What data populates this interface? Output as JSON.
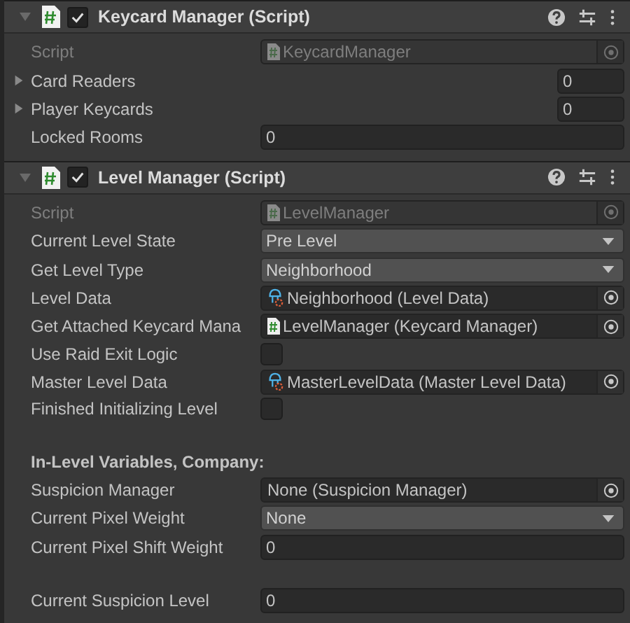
{
  "components": [
    {
      "title": "Keycard Manager (Script)",
      "expanded": true,
      "enabled": true,
      "fields": [
        {
          "kind": "script",
          "label": "Script",
          "value": "KeycardManager"
        },
        {
          "kind": "array",
          "label": "Card Readers",
          "value": "0",
          "expanded": false
        },
        {
          "kind": "array",
          "label": "Player Keycards",
          "value": "0",
          "expanded": false
        },
        {
          "kind": "text",
          "label": "Locked Rooms",
          "value": "0"
        }
      ]
    },
    {
      "title": "Level Manager (Script)",
      "expanded": true,
      "enabled": true,
      "fields": [
        {
          "kind": "script",
          "label": "Script",
          "value": "LevelManager"
        },
        {
          "kind": "enum",
          "label": "Current Level State",
          "value": "Pre Level"
        },
        {
          "kind": "enum",
          "label": "Get Level Type",
          "value": "Neighborhood"
        },
        {
          "kind": "assetref",
          "label": "Level Data",
          "value": "Neighborhood (Level Data)"
        },
        {
          "kind": "scriptref",
          "label": "Get Attached Keycard Mana",
          "value": "LevelManager (Keycard Manager)"
        },
        {
          "kind": "bool",
          "label": "Use Raid Exit Logic",
          "checked": false
        },
        {
          "kind": "assetref",
          "label": "Master Level Data",
          "value": "MasterLevelData (Master Level Data)"
        },
        {
          "kind": "bool",
          "label": "Finished Initializing Level",
          "checked": false
        },
        {
          "kind": "space"
        },
        {
          "kind": "header",
          "label": "In-Level Variables, Company:"
        },
        {
          "kind": "objectref",
          "label": "Suspicion Manager",
          "value": "None (Suspicion Manager)"
        },
        {
          "kind": "enum",
          "label": "Current Pixel Weight",
          "value": "None"
        },
        {
          "kind": "text",
          "label": "Current Pixel Shift Weight",
          "value": "0"
        },
        {
          "kind": "space"
        },
        {
          "kind": "text",
          "label": "Current Suspicion Level",
          "value": "0"
        }
      ]
    }
  ]
}
